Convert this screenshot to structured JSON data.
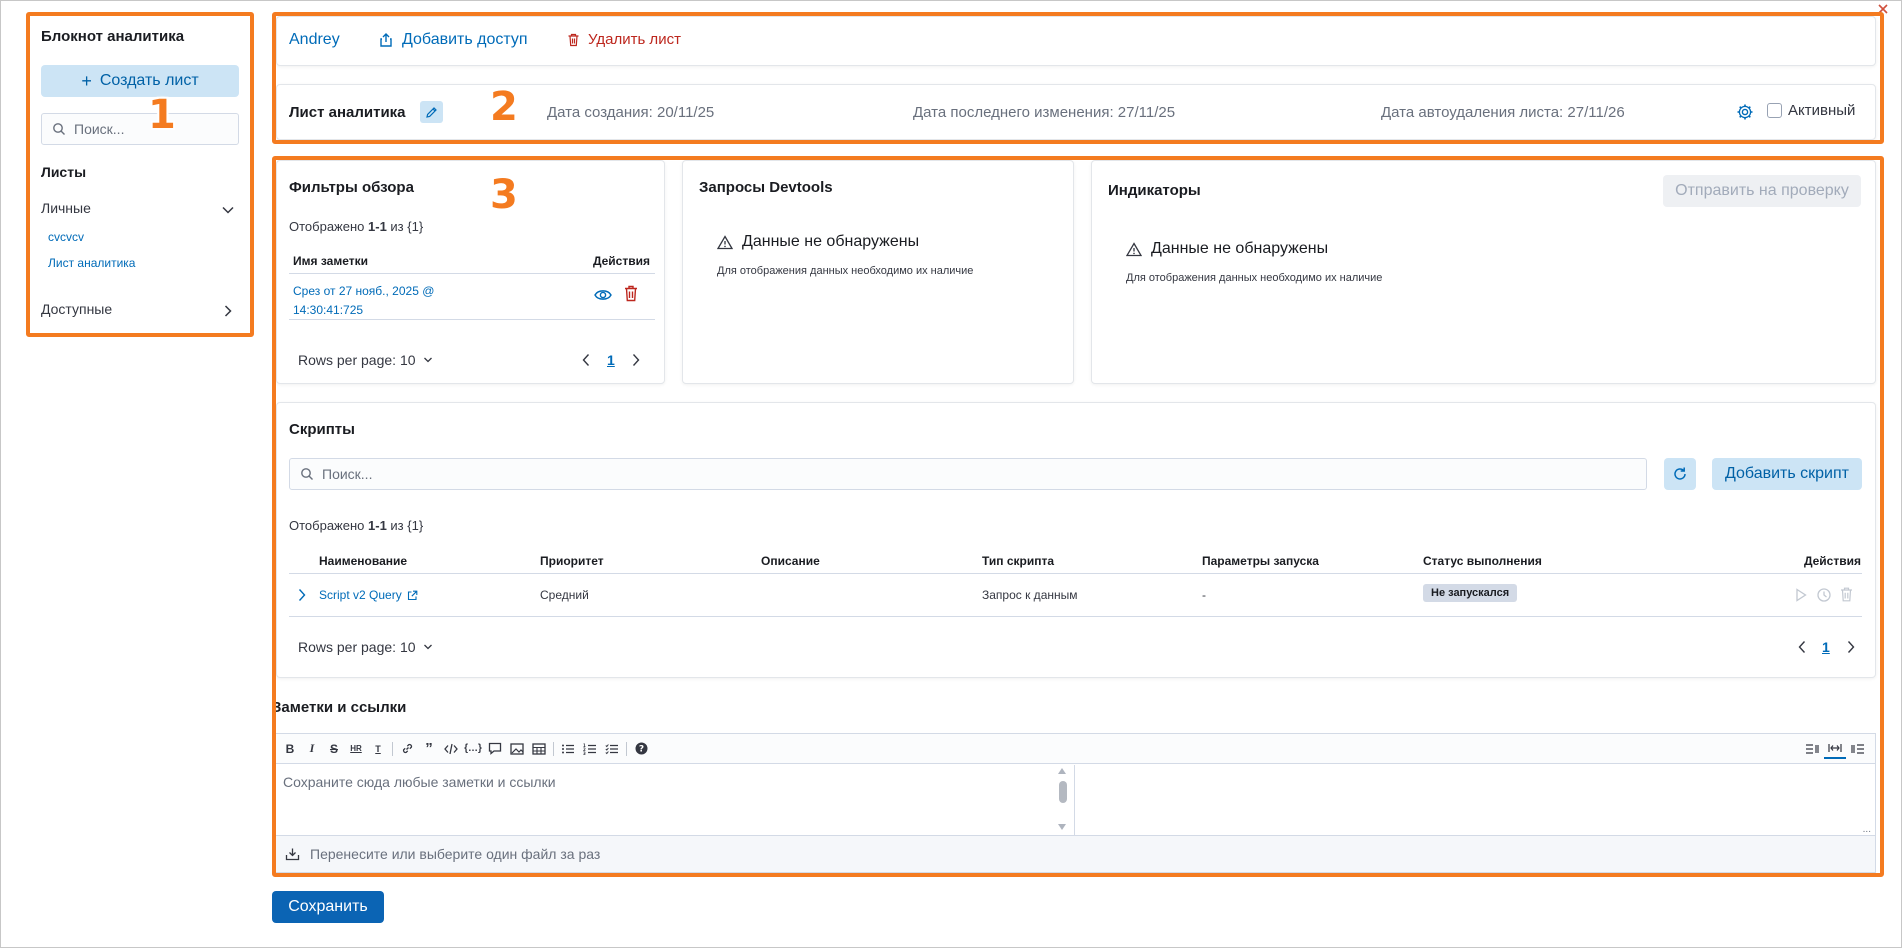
{
  "sidebar": {
    "title": "Блокнот аналитика",
    "create_label": "Создать лист",
    "search_placeholder": "Поиск...",
    "sheets_heading": "Листы",
    "personal_label": "Личные",
    "personal_items": [
      "cvcvcv",
      "Лист аналитика"
    ],
    "available_label": "Доступные"
  },
  "topbar": {
    "user": "Andrey",
    "add_access": "Добавить доступ",
    "delete_sheet": "Удалить лист"
  },
  "sheet": {
    "name": "Лист аналитика",
    "created": "Дата создания: 20/11/25",
    "modified": "Дата последнего изменения: 27/11/25",
    "autodelete": "Дата автоудаления листа: 27/11/26",
    "active_label": "Активный"
  },
  "filters": {
    "title": "Фильтры обзора",
    "shown_prefix": "Отображено ",
    "shown_range": "1-1",
    "shown_suffix": " из {1}",
    "col_name": "Имя заметки",
    "col_actions": "Действия",
    "row_link_line1": "Срез от 27 нояб., 2025 @",
    "row_link_line2": "14:30:41:725",
    "rows_per_page": "Rows per page: 10",
    "page": "1"
  },
  "devtools": {
    "title": "Запросы Devtools",
    "empty_title": "Данные не обнаружены",
    "empty_desc": "Для отображения данных необходимо их наличие"
  },
  "indicators": {
    "title": "Индикаторы",
    "submit_label": "Отправить на проверку",
    "empty_title": "Данные не обнаружены",
    "empty_desc": "Для отображения данных необходимо их наличие"
  },
  "scripts": {
    "title": "Скрипты",
    "search_placeholder": "Поиск...",
    "add_label": "Добавить скрипт",
    "shown_prefix": "Отображено ",
    "shown_range": "1-1",
    "shown_suffix": " из {1}",
    "columns": [
      "Наименование",
      "Приоритет",
      "Описание",
      "Тип скрипта",
      "Параметры запуска",
      "Статус выполнения",
      "Действия"
    ],
    "row": {
      "name": "Script v2 Query",
      "priority": "Средний",
      "description": "",
      "type": "Запрос к данным",
      "params": "-",
      "status": "Не запускался"
    },
    "rows_per_page": "Rows per page: 10",
    "page": "1"
  },
  "notes": {
    "title": "Заметки и ссылки",
    "placeholder": "Сохраните сюда любые заметки и ссылки",
    "dropzone": "Перенесите или выберите один файл за раз",
    "toolbar": [
      "B",
      "I",
      "S",
      "HR",
      "T",
      "link",
      "quote",
      "code",
      "code-block",
      "comment",
      "image",
      "table",
      "ul",
      "ol",
      "tasks",
      "help"
    ],
    "resize_glyph": "..."
  },
  "footer": {
    "save_label": "Сохранить"
  },
  "callouts": [
    "1",
    "2",
    "3"
  ],
  "colors": {
    "accent": "#006bb8",
    "danger": "#bd271e",
    "primary_button": "#0b64b4",
    "annotation": "#f47b20"
  }
}
